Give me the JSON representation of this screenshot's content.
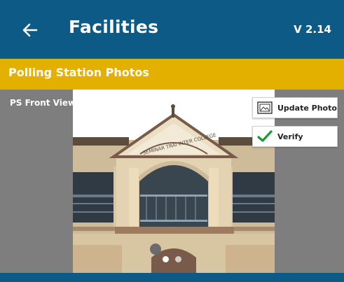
{
  "app_bar": {
    "title": "Facilities",
    "version": "V 2.14",
    "back_icon": "arrow-left-icon",
    "color": "#0e5a86"
  },
  "section": {
    "title": "Polling Station Photos",
    "color": "#e4b000"
  },
  "photo_card": {
    "label": "PS Front View",
    "carousel": {
      "page_count": 2,
      "active_index": 0
    },
    "actions": {
      "update_photo_label": "Update Photo",
      "update_photo_icon": "image-frame-icon",
      "verify_label": "Verify",
      "verify_icon": "check-icon",
      "verify_color": "#1a9a2e"
    }
  },
  "building_sign": "SEMINAR TRAI INTER COLLEGE"
}
